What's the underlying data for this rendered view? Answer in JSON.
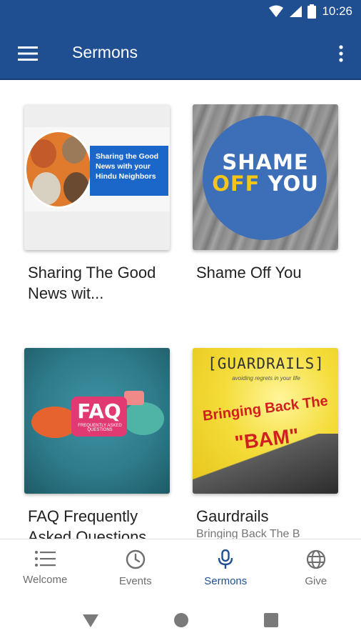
{
  "status_bar": {
    "time": "10:26"
  },
  "app_bar": {
    "title": "Sermons"
  },
  "sermons": [
    {
      "title": "Sharing The Good News wit...",
      "subtitle": "",
      "thumb_text": "Sharing the Good News with your Hindu Neighbors"
    },
    {
      "title": "Shame Off You",
      "subtitle": "",
      "thumb_text_1": "SHAME",
      "thumb_text_2": "OFF",
      "thumb_text_3": "YOU"
    },
    {
      "title": "FAQ Frequently Asked Questions",
      "subtitle": "",
      "thumb_text": "FAQ",
      "thumb_subtext": "FREQUENTLY ASKED QUESTIONS"
    },
    {
      "title": "Gaurdrails",
      "subtitle": "Bringing Back The B",
      "thumb_text": "[GUARDRAILS]",
      "thumb_subtext": "avoiding regrets in your life",
      "thumb_text_2": "Bringing Back The",
      "thumb_text_3": "\"BAM\""
    }
  ],
  "bottom_nav": {
    "items": [
      {
        "label": "Welcome",
        "icon": "list-icon"
      },
      {
        "label": "Events",
        "icon": "clock-icon"
      },
      {
        "label": "Sermons",
        "icon": "microphone-icon"
      },
      {
        "label": "Give",
        "icon": "globe-icon"
      }
    ],
    "active": "Sermons"
  },
  "colors": {
    "primary": "#1f4f91",
    "active_nav": "#1f4f91",
    "inactive_nav": "#6e6e6e"
  }
}
